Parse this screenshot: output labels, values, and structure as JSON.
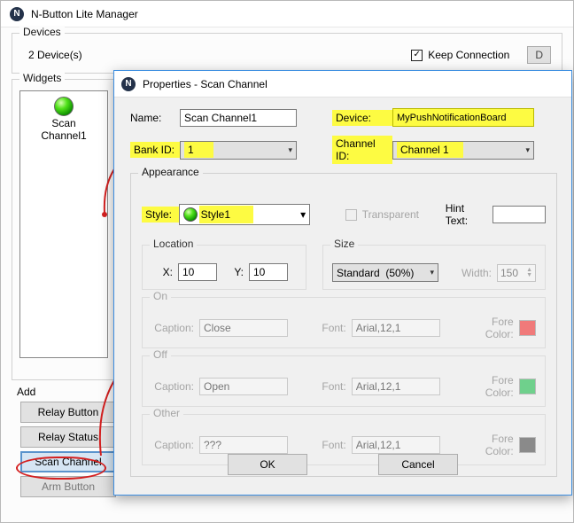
{
  "app_title": "N-Button Lite Manager",
  "devices": {
    "label": "Devices",
    "count_text": "2 Device(s)",
    "keep_connection": "Keep Connection",
    "extra_button": "D"
  },
  "widgets": {
    "label": "Widgets",
    "item_label_line1": "Scan",
    "item_label_line2": "Channel1"
  },
  "add": {
    "label": "Add",
    "relay_button": "Relay Button",
    "relay_status": "Relay Status",
    "scan_channel": "Scan Channel",
    "arm_button": "Arm Button"
  },
  "dialog": {
    "title": "Properties - Scan Channel",
    "name_label": "Name:",
    "name_value": "Scan Channel1",
    "device_label": "Device:",
    "device_value": "MyPushNotificationBoard",
    "bankid_label": "Bank ID:",
    "bankid_value": "1",
    "channelid_label": "Channel ID:",
    "channelid_value": "Channel 1",
    "appearance_label": "Appearance",
    "style_label": "Style:",
    "style_value": "Style1",
    "transparent_label": "Transparent",
    "hinttext_label": "Hint Text:",
    "hinttext_value": "",
    "location": {
      "label": "Location",
      "x_label": "X:",
      "x_value": "10",
      "y_label": "Y:",
      "y_value": "10"
    },
    "size": {
      "label": "Size",
      "mode": "Standard",
      "pct": "(50%)",
      "width_label": "Width:",
      "width_value": "150"
    },
    "on": {
      "label": "On",
      "caption_label": "Caption:",
      "caption_value": "Close",
      "font_label": "Font:",
      "font_value": "Arial,12,1",
      "fore_label": "Fore Color:",
      "swatch": "#f07a7a"
    },
    "off": {
      "label": "Off",
      "caption_label": "Caption:",
      "caption_value": "Open",
      "font_label": "Font:",
      "font_value": "Arial,12,1",
      "fore_label": "Fore Color:",
      "swatch": "#6fd08c"
    },
    "other": {
      "label": "Other",
      "caption_label": "Caption:",
      "caption_value": "???",
      "font_label": "Font:",
      "font_value": "Arial,12,1",
      "fore_label": "Fore Color:",
      "swatch": "#8a8a8a"
    },
    "ok": "OK",
    "cancel": "Cancel"
  }
}
